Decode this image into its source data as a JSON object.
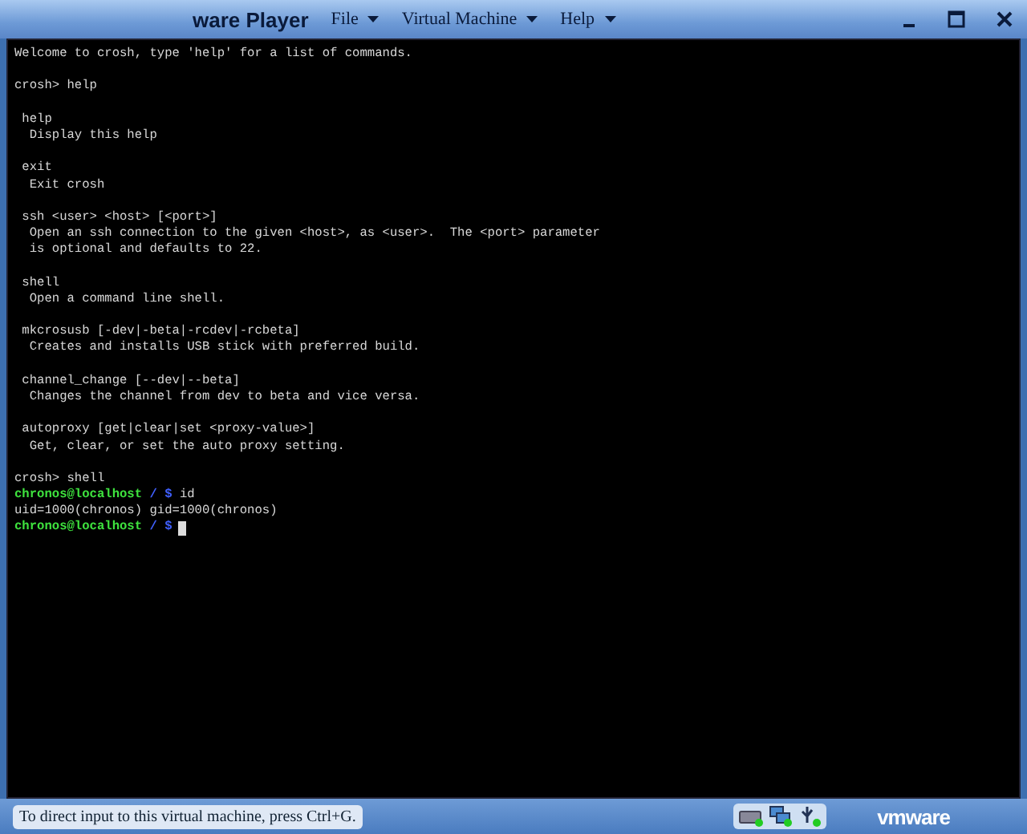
{
  "window": {
    "title": "ware Player"
  },
  "menu": [
    {
      "label": "File"
    },
    {
      "label": "Virtual Machine"
    },
    {
      "label": "Help"
    }
  ],
  "terminal": {
    "lines": [
      {
        "kind": "text",
        "text": "Welcome to crosh, type 'help' for a list of commands."
      },
      {
        "kind": "blank"
      },
      {
        "kind": "text",
        "text": "crosh> help"
      },
      {
        "kind": "blank"
      },
      {
        "kind": "text",
        "text": " help"
      },
      {
        "kind": "text",
        "text": "  Display this help"
      },
      {
        "kind": "blank"
      },
      {
        "kind": "text",
        "text": " exit"
      },
      {
        "kind": "text",
        "text": "  Exit crosh"
      },
      {
        "kind": "blank"
      },
      {
        "kind": "text",
        "text": " ssh <user> <host> [<port>]"
      },
      {
        "kind": "text",
        "text": "  Open an ssh connection to the given <host>, as <user>.  The <port> parameter"
      },
      {
        "kind": "text",
        "text": "  is optional and defaults to 22."
      },
      {
        "kind": "blank"
      },
      {
        "kind": "text",
        "text": " shell"
      },
      {
        "kind": "text",
        "text": "  Open a command line shell."
      },
      {
        "kind": "blank"
      },
      {
        "kind": "text",
        "text": " mkcrosusb [-dev|-beta|-rcdev|-rcbeta]"
      },
      {
        "kind": "text",
        "text": "  Creates and installs USB stick with preferred build."
      },
      {
        "kind": "blank"
      },
      {
        "kind": "text",
        "text": " channel_change [--dev|--beta]"
      },
      {
        "kind": "text",
        "text": "  Changes the channel from dev to beta and vice versa."
      },
      {
        "kind": "blank"
      },
      {
        "kind": "text",
        "text": " autoproxy [get|clear|set <proxy-value>]"
      },
      {
        "kind": "text",
        "text": "  Get, clear, or set the auto proxy setting."
      },
      {
        "kind": "blank"
      },
      {
        "kind": "text",
        "text": "crosh> shell"
      },
      {
        "kind": "prompt",
        "user": "chronos@localhost",
        "path": "/",
        "sign": "$",
        "command": "id"
      },
      {
        "kind": "text",
        "text": "uid=1000(chronos) gid=1000(chronos)"
      },
      {
        "kind": "prompt",
        "user": "chronos@localhost",
        "path": "/",
        "sign": "$",
        "cursor": true
      }
    ]
  },
  "status_bar": {
    "message": "To direct input to this virtual machine, press Ctrl+G.",
    "logo": "vmware"
  }
}
